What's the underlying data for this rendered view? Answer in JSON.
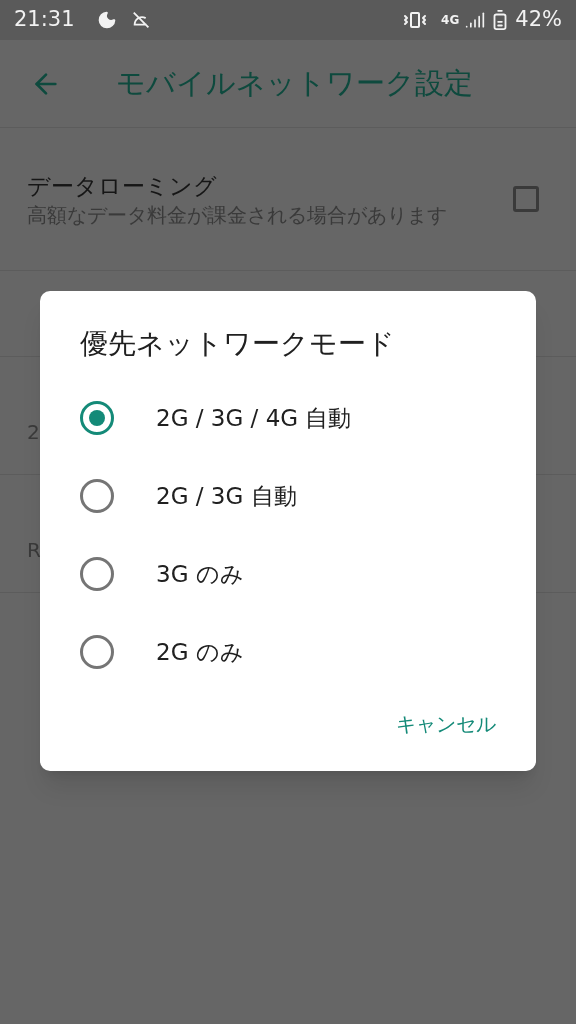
{
  "status_bar": {
    "time": "21:31",
    "network": "4G",
    "battery": "42%"
  },
  "app_bar": {
    "title": "モバイルネットワーク設定"
  },
  "settings": [
    {
      "kind": "checkbox",
      "title": "データローミング",
      "summary": "高額なデータ料金が課金される場合があります",
      "checked": false
    },
    {
      "kind": "plain"
    },
    {
      "kind": "plain",
      "summary": "2"
    },
    {
      "kind": "plain",
      "summary": "R"
    }
  ],
  "dialog": {
    "title": "優先ネットワークモード",
    "options": [
      {
        "label": "2G / 3G / 4G 自動",
        "selected": true
      },
      {
        "label": "2G / 3G 自動",
        "selected": false
      },
      {
        "label": "3G のみ",
        "selected": false
      },
      {
        "label": "2G のみ",
        "selected": false
      }
    ],
    "cancel": "キャンセル"
  }
}
